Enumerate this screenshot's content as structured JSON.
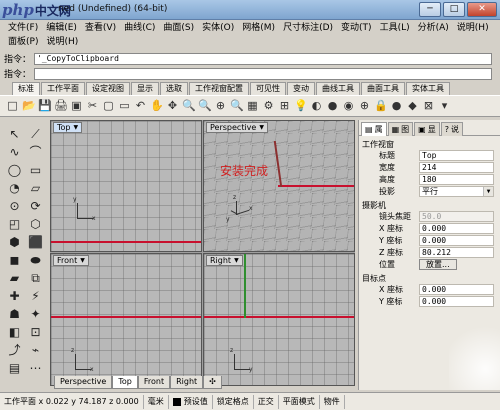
{
  "window": {
    "watermark_php": "php",
    "watermark_cn": "中文网",
    "title": "ned (Undefined) (64-bit)",
    "min": "─",
    "max": "□",
    "close": "✕"
  },
  "menu": [
    "文件(F)",
    "编辑(E)",
    "查看(V)",
    "曲线(C)",
    "曲面(S)",
    "实体(O)",
    "网格(M)",
    "尺寸标注(D)",
    "变动(T)",
    "工具(L)",
    "分析(A)",
    "说明(H)",
    "面板(P)",
    "说明(H)"
  ],
  "command": {
    "history_label": "指令：",
    "history_value": "'_CopyToClipboard",
    "prompt_label": "指令：",
    "prompt_value": ""
  },
  "tabs": [
    "标准",
    "工作平面",
    "设定视图",
    "显示",
    "选取",
    "工作视窗配置",
    "可见性",
    "变动",
    "曲线工具",
    "曲面工具",
    "实体工具"
  ],
  "toolbar_icons": [
    "□",
    "📂",
    "💾",
    "🖨",
    "▣",
    "✂",
    "▢",
    "▭",
    "↶",
    "✋",
    "✥",
    "🔍",
    "🔍",
    "⊕",
    "🔍",
    "▦",
    "⚙",
    "⊞",
    "💡",
    "◐",
    "●",
    "◉",
    "⊕",
    "🔒",
    "●",
    "◆",
    "⊠",
    "▾"
  ],
  "left_tools": [
    "↖",
    "⟋",
    "∿",
    "⌒",
    "◯",
    "▭",
    "◔",
    "▱",
    "⊙",
    "⟳",
    "◰",
    "⬡",
    "⬢",
    "⬛",
    "◼",
    "⬬",
    "▰",
    "⧉",
    "✚",
    "⚡",
    "☗",
    "✦",
    "◧",
    "⊡",
    "⤴",
    "⌁",
    "▤",
    "⋯"
  ],
  "viewports": {
    "top": "Top",
    "perspective": "Perspective",
    "front": "Front",
    "right": "Right",
    "axis_x": "x",
    "axis_y": "y",
    "axis_z": "z"
  },
  "overlay_text": "安装完成",
  "vp_tabs": [
    "Perspective",
    "Top",
    "Front",
    "Right",
    "✣"
  ],
  "panel": {
    "tabs": [
      {
        "icon": "▤",
        "label": "属"
      },
      {
        "icon": "▦",
        "label": "图"
      },
      {
        "icon": "▣",
        "label": "显"
      },
      {
        "icon": "?",
        "label": "说"
      }
    ],
    "section_viewport": "工作视窗",
    "title_key": "标题",
    "title_val": "Top",
    "width_key": "宽度",
    "width_val": "214",
    "height_key": "高度",
    "height_val": "180",
    "projection_key": "投影",
    "projection_val": "平行",
    "section_camera": "摄影机",
    "lens_key": "镜头焦距",
    "lens_val": "50.0",
    "cx_key": "X 座标",
    "cx_val": "0.000",
    "cy_key": "Y 座标",
    "cy_val": "0.000",
    "cz_key": "Z 座标",
    "cz_val": "80.212",
    "pos_key": "位置",
    "pos_btn": "放置...",
    "section_target": "目标点",
    "tx_key": "X 座标",
    "tx_val": "0.000",
    "ty_key": "Y 座标",
    "ty_val": "0.000"
  },
  "status": {
    "coords": "工作平面 x 0.022   y 74.187   z 0.000",
    "units": "毫米",
    "layer": "预设值",
    "snap": "锁定格点",
    "ortho": "正交",
    "planar": "平面模式",
    "object": "物件"
  }
}
